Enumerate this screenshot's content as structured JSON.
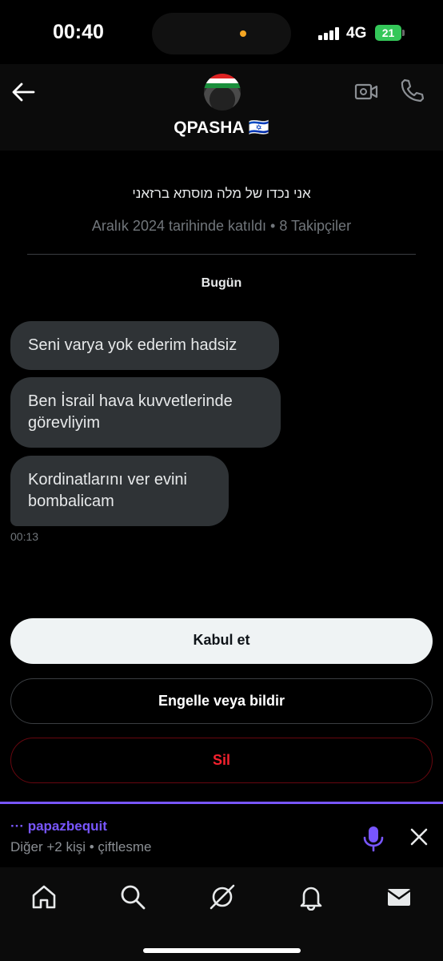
{
  "status_bar": {
    "time": "00:40",
    "network": "4G",
    "battery": "21"
  },
  "header": {
    "back_icon": "arrow-left-icon",
    "name": "QPASHA 🇮🇱",
    "video_icon": "video-camera-icon",
    "call_icon": "phone-icon"
  },
  "profile": {
    "bio": "אני נכדו של מלה מוסתא ברזאני",
    "join_info": "Aralık 2024 tarihinde katıldı • 8 Takipçiler"
  },
  "conversation": {
    "day_label": "Bugün",
    "messages": [
      {
        "text": "Seni varya yok ederim hadsiz"
      },
      {
        "text": "Ben İsrail hava kuvvetlerinde görevliyim"
      },
      {
        "text": "Kordinatlarını ver evini bombalicam"
      }
    ],
    "last_time": "00:13"
  },
  "actions": {
    "accept": "Kabul et",
    "block_report": "Engelle veya bildir",
    "delete": "Sil"
  },
  "space": {
    "host": "··· papazbequit",
    "subtitle": "Diğer +2 kişi • çiftlesme"
  },
  "tabs": [
    {
      "icon": "home-icon"
    },
    {
      "icon": "search-icon"
    },
    {
      "icon": "grok-icon"
    },
    {
      "icon": "bell-icon"
    },
    {
      "icon": "mail-icon"
    }
  ],
  "colors": {
    "background": "#000000",
    "bubble": "#2f3336",
    "accent_purple": "#7856ff",
    "danger": "#f4212e",
    "muted": "#71767b"
  }
}
